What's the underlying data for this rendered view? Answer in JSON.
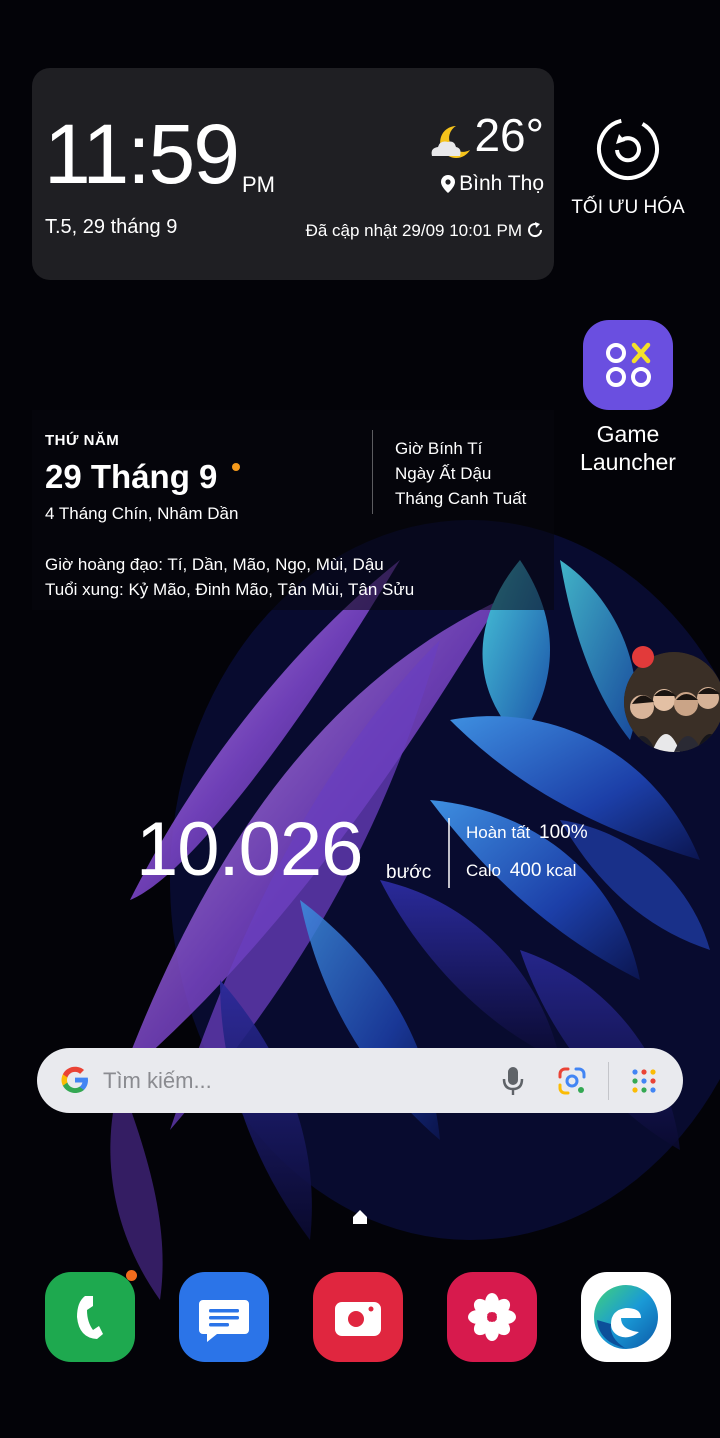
{
  "clock_widget": {
    "time": "11:59",
    "ampm": "PM",
    "date": "T.5, 29 tháng 9",
    "weather": {
      "temperature": "26°",
      "location": "Bình Thọ",
      "updated": "Đã cập nhật 29/09 10:01 PM"
    }
  },
  "optimize": {
    "label": "TỐI ƯU HÓA"
  },
  "game_launcher": {
    "label_line1": "Game",
    "label_line2": "Launcher"
  },
  "calendar_widget": {
    "weekday": "THỨ NĂM",
    "date": "29 Tháng 9",
    "lunar_date": "4 Tháng Chín, Nhâm Dần",
    "hour": "Giờ Bính Tí",
    "day": "Ngày Ất Dậu",
    "month": "Tháng Canh Tuất",
    "good_hours": "Giờ hoàng đạo: Tí, Dần, Mão, Ngọ, Mùi, Dậu",
    "conflicts": "Tuổi xung: Kỷ Mão, Đinh Mão, Tân Mùi, Tân Sửu"
  },
  "steps_widget": {
    "count": "10.026",
    "unit": "bước",
    "complete_label": "Hoàn tất",
    "complete_value": "100%",
    "calo_label": "Calo",
    "calo_value": "400",
    "calo_unit": "kcal"
  },
  "search_bar": {
    "placeholder": "Tìm kiếm..."
  },
  "dock": {
    "apps": [
      "phone-icon",
      "messages-icon",
      "camera-icon",
      "gallery-icon",
      "edge-browser-icon"
    ]
  },
  "colors": {
    "accent_orange": "#f59a1b",
    "game_launcher": "#6a4fe0",
    "phone": "#1ea94f",
    "messages": "#2b74e8",
    "camera": "#e0263f",
    "gallery": "#d71a4d"
  }
}
